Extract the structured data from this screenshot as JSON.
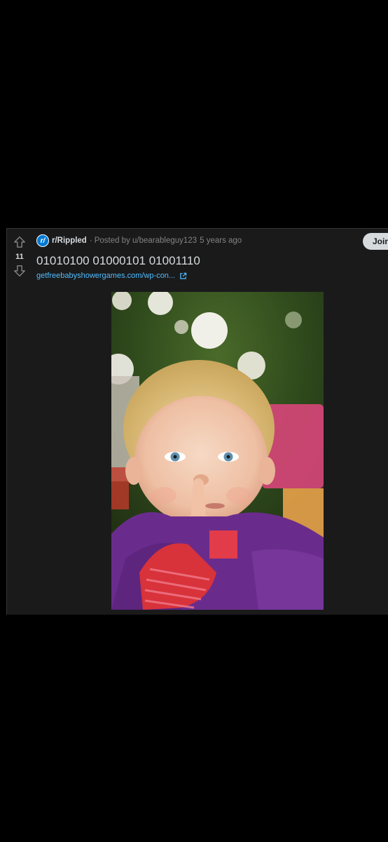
{
  "post": {
    "score": "11",
    "subreddit": "r/Rippled",
    "subreddit_icon": "r/",
    "separator": "·",
    "posted_by": "Posted by u/bearableguy123",
    "age": "5 years ago",
    "join_label": "Join",
    "title": "01010100 01000101 01001110",
    "link_text": "getfreebabyshowergames.com/wp-con...",
    "image_description": "baby-shush-photo"
  },
  "colors": {
    "background": "#000000",
    "card": "#1a1a1b",
    "text_primary": "#d7dadc",
    "text_meta": "#818384",
    "link": "#4fbcff",
    "subreddit_icon": "#0079d3",
    "join_button": "#d7dadc"
  },
  "icons": {
    "upvote": "arrow-up-icon",
    "downvote": "arrow-down-icon",
    "external_link": "external-link-icon"
  }
}
